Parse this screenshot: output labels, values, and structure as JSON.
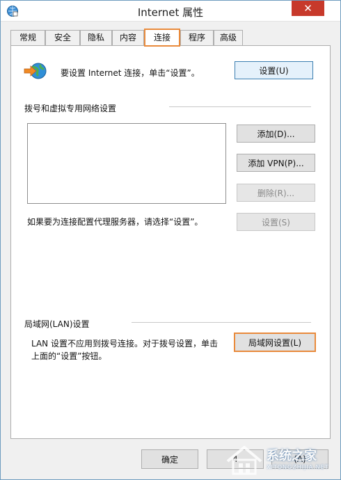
{
  "window": {
    "title": "Internet 属性",
    "close_glyph": "✕"
  },
  "tabs": [
    "常规",
    "安全",
    "隐私",
    "内容",
    "连接",
    "程序",
    "高级"
  ],
  "setup": {
    "icon": "globe-arrow-icon",
    "text": "要设置 Internet 连接，单击“设置”。",
    "button": "设置(U)"
  },
  "dialup": {
    "heading": "拨号和虚拟专用网络设置",
    "add": "添加(D)...",
    "add_vpn": "添加 VPN(P)...",
    "remove": "删除(R)...",
    "settings": "设置(S)",
    "proxy_note": "如果要为连接配置代理服务器，请选择“设置”。"
  },
  "lan": {
    "heading": "局域网(LAN)设置",
    "note_line1": "LAN 设置不应用到拨号连接。对于拨号设置，单击",
    "note_line2": "上面的“设置”按钮。",
    "button": "局域网设置(L)"
  },
  "footer": {
    "ok": "确定",
    "cancel_partial": "4",
    "apply_partial": "(A)"
  },
  "watermark": {
    "text": "系统之家",
    "sub": "XITONGZHIJIA.NET"
  },
  "colors": {
    "highlight": "#e98a3b",
    "close": "#c7392b",
    "title_border": "#6d9bbf"
  }
}
